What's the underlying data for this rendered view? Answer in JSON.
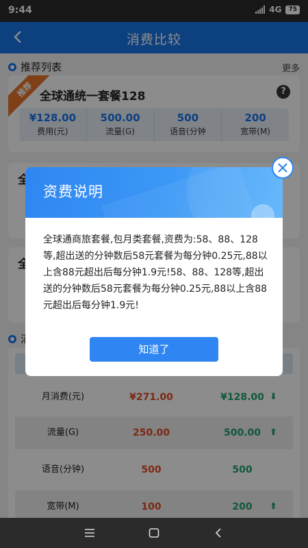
{
  "status_bar": {
    "time": "9:44",
    "network": "4G",
    "battery": "75"
  },
  "header": {
    "title": "消费比较"
  },
  "recommend": {
    "section_title": "推荐列表",
    "more": "更多",
    "badge": "推荐",
    "package_name": "全球通统一套餐128",
    "stats": [
      {
        "value": "¥128.00",
        "label": "费用(元)"
      },
      {
        "value": "500.00",
        "label": "流量(G)"
      },
      {
        "value": "500",
        "label": "语音(分钟"
      },
      {
        "value": "200",
        "label": "宽带(M)"
      }
    ],
    "peek_card_2": "全",
    "peek_card_3": "全"
  },
  "compare": {
    "section_title": "消",
    "rows": [
      {
        "label": "月消费(元)",
        "current": "¥271.00",
        "recommended": "¥128.00",
        "arrow": "down"
      },
      {
        "label": "流量(G)",
        "current": "250.00",
        "recommended": "500.00",
        "arrow": "up"
      },
      {
        "label": "语音(分钟)",
        "current": "500",
        "recommended": "500",
        "arrow": ""
      },
      {
        "label": "宽带(M)",
        "current": "100",
        "recommended": "200",
        "arrow": "up"
      }
    ]
  },
  "modal": {
    "title": "资费说明",
    "body": "全球通商旅套餐,包月类套餐,资费为:58、88、128等,超出送的分钟数后58元套餐为每分钟0.25元,88以上含88元超出后每分钟1.9元!58、88、128等,超出送的分钟数后58元套餐为每分钟0.25元,88以上含88元超出后每分钟1.9元!",
    "ok_label": "知道了"
  },
  "colors": {
    "primary": "#1976e8",
    "badge_orange": "#e8762c",
    "decrease_red": "#e24b25",
    "increase_green": "#21a06a"
  },
  "icons": {
    "back": "chevron-left-icon",
    "help": "question-circle-icon",
    "close": "close-circle-icon",
    "up": "arrow-up-icon",
    "down": "arrow-down-icon"
  }
}
